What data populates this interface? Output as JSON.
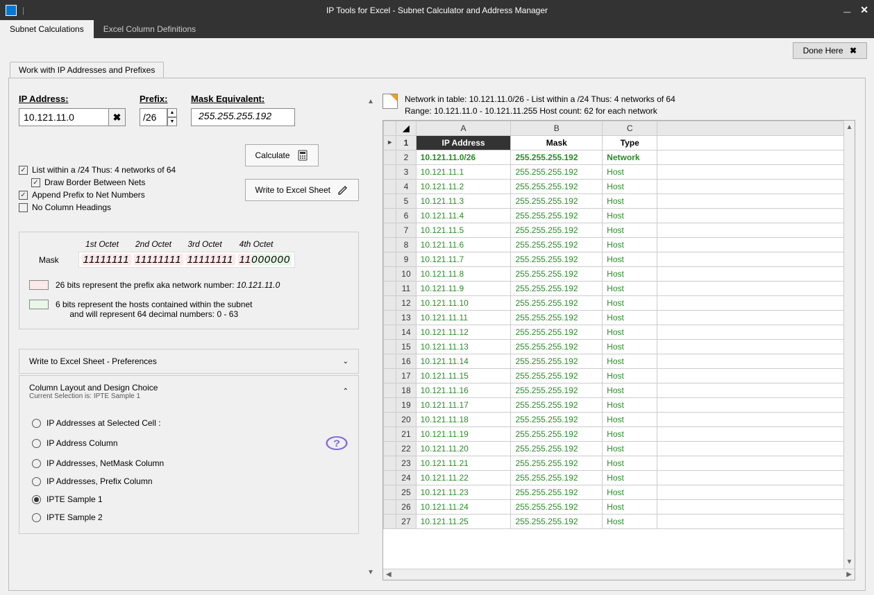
{
  "titlebar": {
    "title": "IP Tools for Excel - Subnet Calculator and Address Manager"
  },
  "tabs": [
    "Subnet Calculations",
    "Excel Column Definitions"
  ],
  "done_label": "Done Here",
  "subtab": "Work with IP Addresses and Prefixes",
  "inputs": {
    "ip_label": "IP Address:",
    "ip_value": "10.121.11.0",
    "prefix_label": "Prefix:",
    "prefix_value": "/26",
    "mask_label": "Mask Equivalent:",
    "mask_value": "255.255.255.192"
  },
  "checks": {
    "list24": "List within a /24 Thus: 4 networks of 64",
    "border": "Draw Border Between Nets",
    "append": "Append Prefix to Net Numbers",
    "nohdr": "No Column Headings"
  },
  "buttons": {
    "calculate": "Calculate",
    "write": "Write to Excel Sheet"
  },
  "maskbox": {
    "label": "Mask",
    "headers": [
      "1st Octet",
      "2nd Octet",
      "3rd Octet",
      "4th Octet"
    ],
    "oct1": "11111111",
    "oct2": "11111111",
    "oct3": "11111111",
    "oct4a": "11",
    "oct4b": "000000",
    "legend_net": "26 bits represent the prefix aka network number: ",
    "legend_net_ip": "10.121.11.0",
    "legend_host_l1": "6 bits represent the hosts contained within the subnet",
    "legend_host_l2": "and will represent 64 decimal numbers: 0 - 63"
  },
  "acc": {
    "pref_title": "Write to Excel Sheet  - Preferences",
    "layout_title": "Column Layout and Design Choice",
    "layout_sub": "Current Selection is: IPTE Sample 1",
    "radios": [
      "IP Addresses at Selected Cell :",
      "IP Address Column",
      "IP Addresses, NetMask Column",
      "IP Addresses, Prefix Column",
      "IPTE Sample 1",
      "IPTE Sample 2"
    ],
    "selected": 4
  },
  "info": {
    "l1a": "Network in table:  10.121.11.0/26  -  List within a /24 Thus: 4 networks of 64",
    "l2a": "Range:  10.121.11.0 - 10.121.11.255    Host count:  62 for each network"
  },
  "grid": {
    "colA": "A",
    "colB": "B",
    "colC": "C",
    "h_ip": "IP Address",
    "h_mask": "Mask",
    "h_type": "Type",
    "rows": [
      {
        "n": 2,
        "ip": "10.121.11.0/26",
        "mask": "255.255.255.192",
        "type": "Network",
        "bold": true
      },
      {
        "n": 3,
        "ip": "10.121.11.1",
        "mask": "255.255.255.192",
        "type": "Host"
      },
      {
        "n": 4,
        "ip": "10.121.11.2",
        "mask": "255.255.255.192",
        "type": "Host"
      },
      {
        "n": 5,
        "ip": "10.121.11.3",
        "mask": "255.255.255.192",
        "type": "Host"
      },
      {
        "n": 6,
        "ip": "10.121.11.4",
        "mask": "255.255.255.192",
        "type": "Host"
      },
      {
        "n": 7,
        "ip": "10.121.11.5",
        "mask": "255.255.255.192",
        "type": "Host"
      },
      {
        "n": 8,
        "ip": "10.121.11.6",
        "mask": "255.255.255.192",
        "type": "Host"
      },
      {
        "n": 9,
        "ip": "10.121.11.7",
        "mask": "255.255.255.192",
        "type": "Host"
      },
      {
        "n": 10,
        "ip": "10.121.11.8",
        "mask": "255.255.255.192",
        "type": "Host"
      },
      {
        "n": 11,
        "ip": "10.121.11.9",
        "mask": "255.255.255.192",
        "type": "Host"
      },
      {
        "n": 12,
        "ip": "10.121.11.10",
        "mask": "255.255.255.192",
        "type": "Host"
      },
      {
        "n": 13,
        "ip": "10.121.11.11",
        "mask": "255.255.255.192",
        "type": "Host"
      },
      {
        "n": 14,
        "ip": "10.121.11.12",
        "mask": "255.255.255.192",
        "type": "Host"
      },
      {
        "n": 15,
        "ip": "10.121.11.13",
        "mask": "255.255.255.192",
        "type": "Host"
      },
      {
        "n": 16,
        "ip": "10.121.11.14",
        "mask": "255.255.255.192",
        "type": "Host"
      },
      {
        "n": 17,
        "ip": "10.121.11.15",
        "mask": "255.255.255.192",
        "type": "Host"
      },
      {
        "n": 18,
        "ip": "10.121.11.16",
        "mask": "255.255.255.192",
        "type": "Host"
      },
      {
        "n": 19,
        "ip": "10.121.11.17",
        "mask": "255.255.255.192",
        "type": "Host"
      },
      {
        "n": 20,
        "ip": "10.121.11.18",
        "mask": "255.255.255.192",
        "type": "Host"
      },
      {
        "n": 21,
        "ip": "10.121.11.19",
        "mask": "255.255.255.192",
        "type": "Host"
      },
      {
        "n": 22,
        "ip": "10.121.11.20",
        "mask": "255.255.255.192",
        "type": "Host"
      },
      {
        "n": 23,
        "ip": "10.121.11.21",
        "mask": "255.255.255.192",
        "type": "Host"
      },
      {
        "n": 24,
        "ip": "10.121.11.22",
        "mask": "255.255.255.192",
        "type": "Host"
      },
      {
        "n": 25,
        "ip": "10.121.11.23",
        "mask": "255.255.255.192",
        "type": "Host"
      },
      {
        "n": 26,
        "ip": "10.121.11.24",
        "mask": "255.255.255.192",
        "type": "Host"
      },
      {
        "n": 27,
        "ip": "10.121.11.25",
        "mask": "255.255.255.192",
        "type": "Host"
      }
    ]
  }
}
